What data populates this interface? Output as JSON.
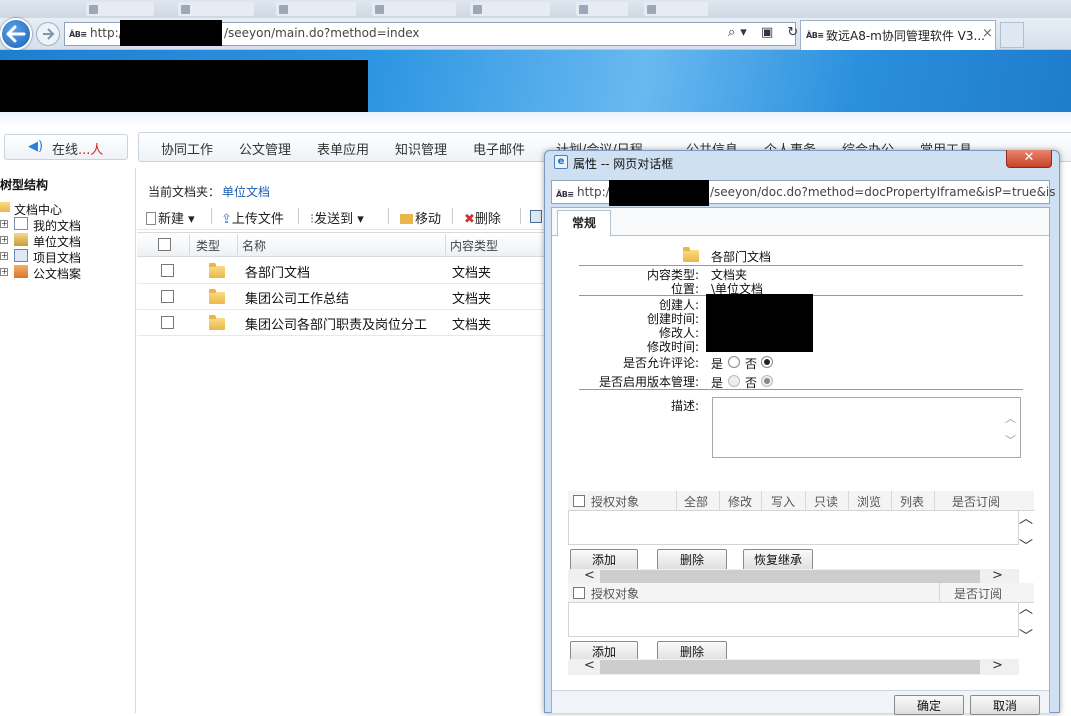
{
  "browser": {
    "address_http": "http://",
    "address_path": "/seeyon/main.do?method=index",
    "address_icons": "⌕▾ ▣ ↻",
    "tab_title": "致远A8-m协同管理软件 V3...",
    "tab_close": "×",
    "abm": "ÄB≡"
  },
  "nav": {
    "online_label": "在线",
    "online_suffix": "...人",
    "menu": [
      "协同工作",
      "公文管理",
      "表单应用",
      "知识管理",
      "电子邮件",
      "计划/会议/日程",
      "公共信息",
      "个人事务",
      "综合办公",
      "常用工具"
    ]
  },
  "tree": {
    "title": "树型结构",
    "root": "文档中心",
    "items": [
      "我的文档",
      "单位文档",
      "项目文档",
      "公文档案"
    ]
  },
  "content": {
    "crumb_label": "当前文档夹：",
    "crumb_value": "单位文档",
    "toolbar": {
      "new": "新建",
      "upload": "上传文件",
      "send": "发送到",
      "move": "移动",
      "delete": "删除"
    },
    "columns": {
      "type": "类型",
      "name": "名称",
      "content_type": "内容类型"
    },
    "rows": [
      {
        "name": "各部门文档",
        "type": "文档夹"
      },
      {
        "name": "集团公司工作总结",
        "type": "文档夹"
      },
      {
        "name": "集团公司各部门职责及岗位分工",
        "type": "文档夹"
      }
    ]
  },
  "dialog": {
    "title": "属性 -- 网页对话框",
    "close": "✕",
    "addr_http": "http://",
    "addr_path": "/seeyon/doc.do?method=docPropertyIframe&isP=true&is",
    "tab": "常规",
    "folder_name": "各部门文档",
    "labels": {
      "content_type": "内容类型:",
      "location": "位置:",
      "creator": "创建人:",
      "created": "创建时间:",
      "modifier": "修改人:",
      "modified": "修改时间:",
      "allow_comment": "是否允许评论:",
      "version_mgmt": "是否启用版本管理:",
      "desc": "描述:"
    },
    "values": {
      "content_type": "文档夹",
      "location": "\\单位文档"
    },
    "yes": "是",
    "no": "否",
    "allow_comment": "no",
    "version_mgmt": "no",
    "grid1_cols": [
      "授权对象",
      "全部",
      "修改",
      "写入",
      "只读",
      "浏览",
      "列表",
      "是否订阅"
    ],
    "grid2_cols": [
      "授权对象",
      "是否订阅"
    ],
    "buttons": {
      "add": "添加",
      "delete": "删除",
      "restore": "恢复继承",
      "ok": "确定",
      "cancel": "取消"
    },
    "arrows": {
      "up": "︿",
      "down": "﹀",
      "left": "<",
      "right": ">"
    }
  }
}
